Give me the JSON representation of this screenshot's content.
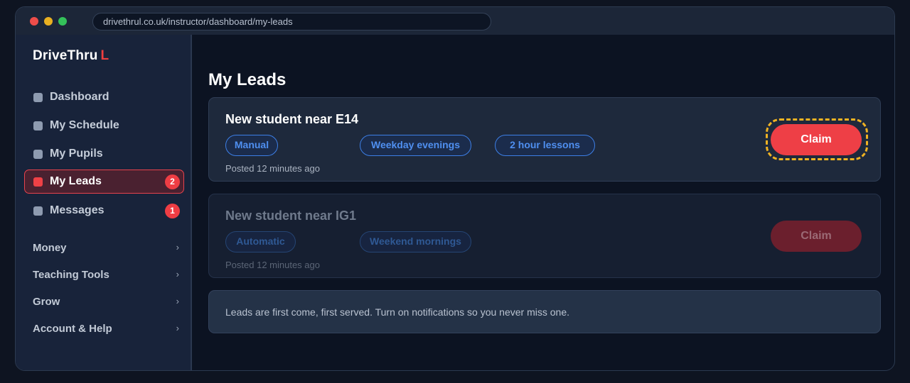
{
  "browser": {
    "url": "drivethrul.co.uk/instructor/dashboard/my-leads"
  },
  "brand": {
    "name": "DriveThru",
    "accent": "L",
    "accent_color": "#ef3f3f"
  },
  "sidebar": {
    "items": [
      {
        "label": "Dashboard",
        "badge": ""
      },
      {
        "label": "My Schedule",
        "badge": ""
      },
      {
        "label": "My Pupils",
        "badge": ""
      },
      {
        "label": "My Leads",
        "badge": "2",
        "active": true
      },
      {
        "label": "Messages",
        "badge": "1"
      }
    ],
    "groups": [
      {
        "label": "Money",
        "chevron": "›"
      },
      {
        "label": "Teaching Tools",
        "chevron": "›"
      },
      {
        "label": "Grow",
        "chevron": "›"
      },
      {
        "label": "Account & Help",
        "chevron": "›"
      }
    ]
  },
  "main": {
    "title": "My Leads",
    "leads": [
      {
        "title": "New student near E14",
        "tags": [
          "Manual",
          "Weekday evenings",
          "2 hour lessons"
        ],
        "posted": "Posted 12 minutes ago",
        "claim_label": "Claim",
        "state": "focused"
      },
      {
        "title": "New student near IG1",
        "tags": [
          "Automatic",
          "Weekend mornings"
        ],
        "posted": "Posted 12 minutes ago",
        "claim_label": "Claim",
        "state": "disabled"
      }
    ],
    "notice": "Leads are first come, first served. Turn on notifications so you never miss one."
  },
  "colors": {
    "accent": "#ee3f46",
    "tag_blue": "#3d7fe6",
    "focus_ring": "#f0b323"
  }
}
